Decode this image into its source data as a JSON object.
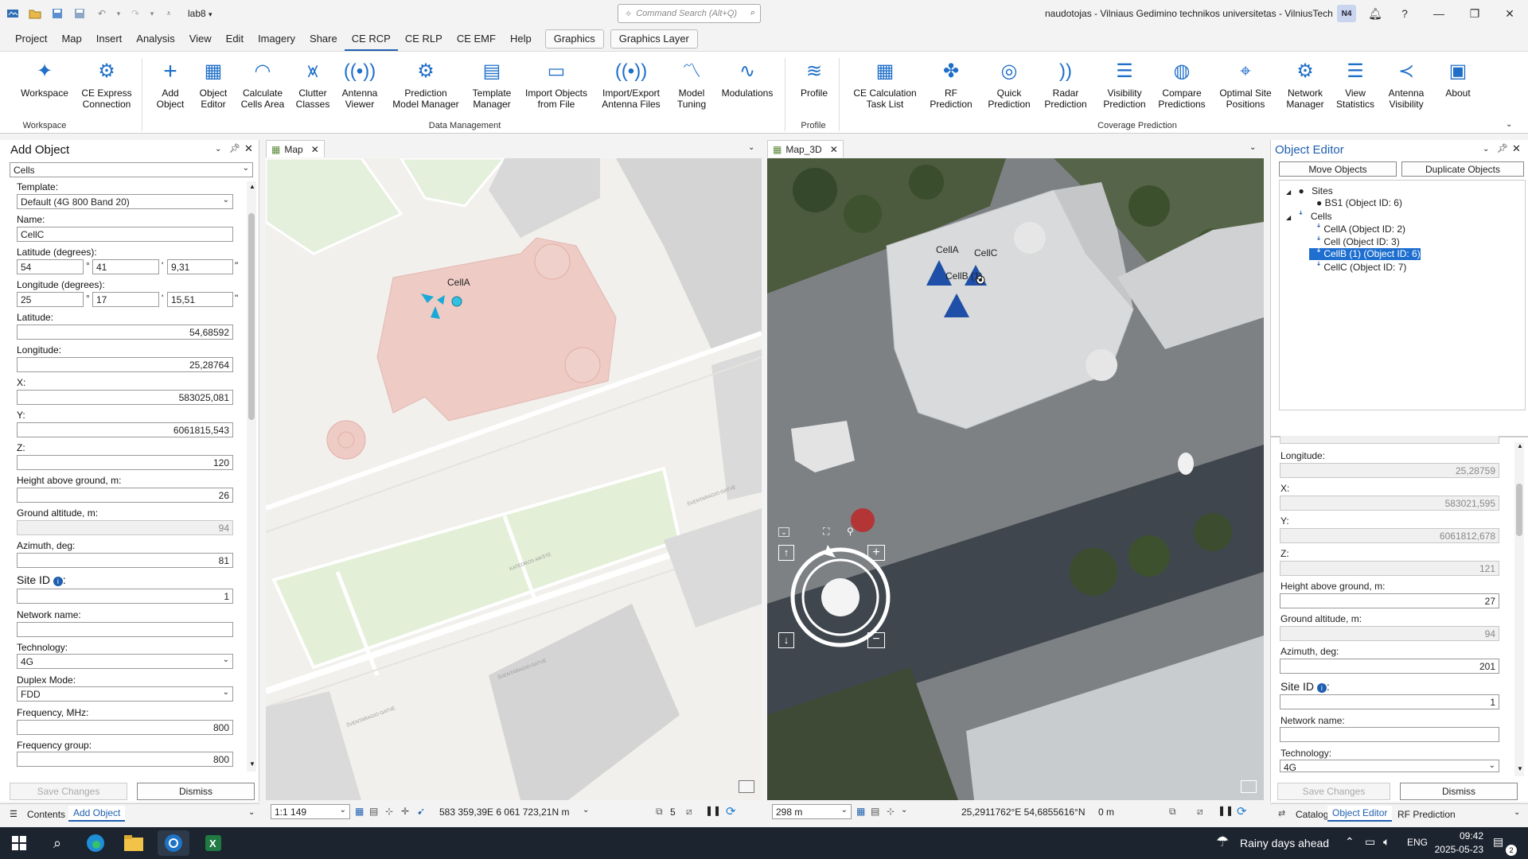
{
  "titlebar": {
    "project": "lab8",
    "search_placeholder": "Command Search (Alt+Q)",
    "account": "naudotojas - Vilniaus Gedimino technikos universitetas - VilniusTech",
    "avatar": "N4"
  },
  "menu": [
    "Project",
    "Map",
    "Insert",
    "Analysis",
    "View",
    "Edit",
    "Imagery",
    "Share",
    "CE RCP",
    "CE RLP",
    "CE EMF",
    "Help"
  ],
  "context_tabs": [
    "Graphics",
    "Graphics Layer"
  ],
  "ribbon": {
    "buttons": [
      {
        "l1": "Workspace",
        "l2": ""
      },
      {
        "l1": "CE Express",
        "l2": "Connection"
      },
      {
        "l1": "Add",
        "l2": "Object"
      },
      {
        "l1": "Object",
        "l2": "Editor"
      },
      {
        "l1": "Calculate",
        "l2": "Cells Area"
      },
      {
        "l1": "Clutter",
        "l2": "Classes"
      },
      {
        "l1": "Antenna",
        "l2": "Viewer"
      },
      {
        "l1": "Prediction",
        "l2": "Model Manager"
      },
      {
        "l1": "Template",
        "l2": "Manager"
      },
      {
        "l1": "Import Objects",
        "l2": "from File"
      },
      {
        "l1": "Import/Export",
        "l2": "Antenna Files"
      },
      {
        "l1": "Model",
        "l2": "Tuning"
      },
      {
        "l1": "Modulations",
        "l2": ""
      },
      {
        "l1": "Profile",
        "l2": ""
      },
      {
        "l1": "CE Calculation",
        "l2": "Task List"
      },
      {
        "l1": "RF",
        "l2": "Prediction"
      },
      {
        "l1": "Quick",
        "l2": "Prediction"
      },
      {
        "l1": "Radar",
        "l2": "Prediction"
      },
      {
        "l1": "Visibility",
        "l2": "Prediction"
      },
      {
        "l1": "Compare",
        "l2": "Predictions"
      },
      {
        "l1": "Optimal Site",
        "l2": "Positions"
      },
      {
        "l1": "Network",
        "l2": "Manager"
      },
      {
        "l1": "View",
        "l2": "Statistics"
      },
      {
        "l1": "Antenna",
        "l2": "Visibility"
      },
      {
        "l1": "About",
        "l2": ""
      }
    ],
    "groups": [
      "Workspace",
      "Data Management",
      "Profile",
      "Coverage Prediction"
    ]
  },
  "add_object": {
    "title": "Add Object",
    "type": "Cells",
    "template_label": "Template:",
    "template": "Default (4G 800 Band 20)",
    "name_label": "Name:",
    "name": "CellC",
    "lat_deg_label": "Latitude (degrees):",
    "lat_d": "54",
    "lat_m": "41",
    "lat_s": "9,31",
    "lon_deg_label": "Longitude (degrees):",
    "lon_d": "25",
    "lon_m": "17",
    "lon_s": "15,51",
    "deg_sym": "°",
    "min_sym": "'",
    "sec_sym": "\"",
    "lat_label": "Latitude:",
    "lat": "54,68592",
    "lon_label": "Longitude:",
    "lon": "25,28764",
    "x_label": "X:",
    "x": "583025,081",
    "y_label": "Y:",
    "y": "6061815,543",
    "z_label": "Z:",
    "z": "120",
    "hag_label": "Height above ground, m:",
    "hag": "26",
    "ga_label": "Ground altitude, m:",
    "ga": "94",
    "az_label": "Azimuth, deg:",
    "az": "81",
    "site_label": "Site ID",
    "site": "1",
    "net_label": "Network name:",
    "net": "",
    "tech_label": "Technology:",
    "tech": "4G",
    "duplex_label": "Duplex Mode:",
    "duplex": "FDD",
    "freq_label": "Frequency, MHz:",
    "freq": "800",
    "fgroup_label": "Frequency group:",
    "fgroup": "800",
    "save": "Save Changes",
    "dismiss": "Dismiss",
    "tabs": [
      "Contents",
      "Add Object"
    ]
  },
  "map2d": {
    "tab": "Map",
    "cell_label": "CellA",
    "street1": "KATEDROS AIKŠTĖ",
    "street2": "ŠVENTARAGIO GATVĖ",
    "street3": "ŠVENTARAGIO GATVĖ",
    "street4": "ŠVENTARAGIO GATVĖ",
    "scale": "1:1 149",
    "coords": "583 359,39E 6 061 723,21N m",
    "sel_count": "5"
  },
  "map3d": {
    "tab": "Map_3D",
    "labels": [
      "CellA",
      "CellC",
      "CellB (1)"
    ],
    "dist": "298 m",
    "coords": "25,2911762°E 54,6855616°N",
    "elev": "0 m"
  },
  "object_editor": {
    "title": "Object Editor",
    "move": "Move Objects",
    "duplicate": "Duplicate Objects",
    "tree": [
      {
        "text": "Sites",
        "level": 0
      },
      {
        "text": "BS1 (Object ID: 6)",
        "level": 1
      },
      {
        "text": "Cells",
        "level": 0
      },
      {
        "text": "CellA (Object ID: 2)",
        "level": 1
      },
      {
        "text": "Cell (Object ID: 3)",
        "level": 1
      },
      {
        "text": "CellB (1) (Object ID: 6)",
        "level": 1,
        "selected": true
      },
      {
        "text": "CellC (Object ID: 7)",
        "level": 1
      }
    ],
    "lon_label": "Longitude:",
    "lon": "25,28759",
    "x_label": "X:",
    "x": "583021,595",
    "y_label": "Y:",
    "y": "6061812,678",
    "z_label": "Z:",
    "z": "121",
    "hag_label": "Height above ground, m:",
    "hag": "27",
    "ga_label": "Ground altitude, m:",
    "ga": "94",
    "az_label": "Azimuth, deg:",
    "az": "201",
    "site_label": "Site ID",
    "site": "1",
    "net_label": "Network name:",
    "net": "",
    "tech_label": "Technology:",
    "tech": "4G",
    "save": "Save Changes",
    "dismiss": "Dismiss",
    "tabs": [
      "Catalog",
      "Object Editor",
      "RF Prediction"
    ]
  },
  "taskbar": {
    "weather": "Rainy days ahead",
    "lang": "ENG",
    "time": "09:42",
    "date": "2025-05-23"
  }
}
